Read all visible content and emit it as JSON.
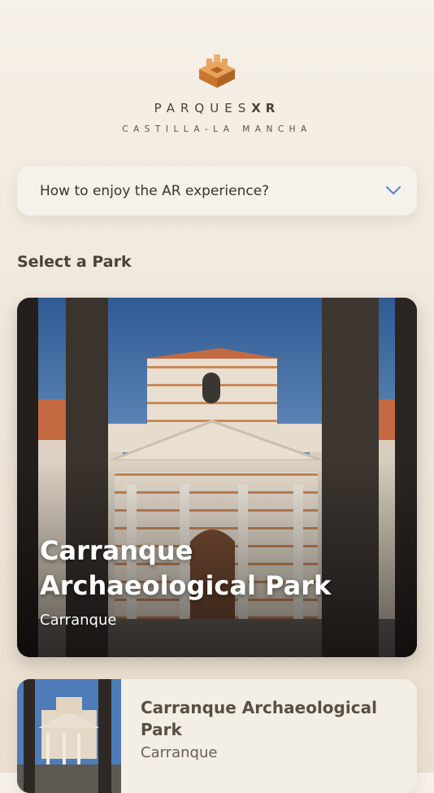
{
  "brand": {
    "name_main": "PARQUES",
    "name_accent": "XR",
    "region": "CASTILLA-LA MANCHA",
    "logo_icon": "castle-tower-icon"
  },
  "help": {
    "question": "How to enjoy the AR experience?",
    "icon": "chevron-down-icon"
  },
  "section_title": "Select a Park",
  "featured_park": {
    "title": "Carranque Archaeological Park",
    "location": "Carranque"
  },
  "parks": [
    {
      "title": "Carranque Archaeological Park",
      "location": "Carranque"
    }
  ],
  "colors": {
    "accent": "#d9893c",
    "chevron": "#5b7fd6",
    "background": "#f1e9dd"
  }
}
